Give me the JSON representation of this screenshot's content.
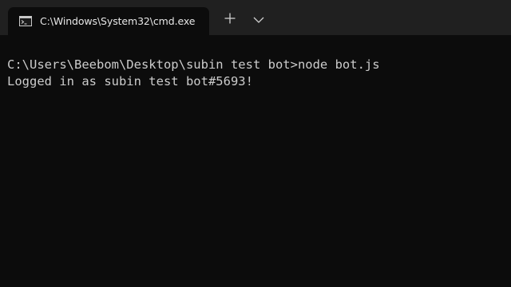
{
  "tab": {
    "title": "C:\\Windows\\System32\\cmd.exe",
    "icon": "cmd-icon"
  },
  "toolbar": {
    "new_tab_icon": "plus-icon",
    "dropdown_icon": "chevron-down-icon"
  },
  "terminal": {
    "lines": [
      "C:\\Users\\Beebom\\Desktop\\subin test bot>node bot.js",
      "Logged in as subin test bot#5693!"
    ]
  },
  "colors": {
    "background": "#0c0c0c",
    "titlebar": "#202020",
    "text": "#cccccc"
  }
}
